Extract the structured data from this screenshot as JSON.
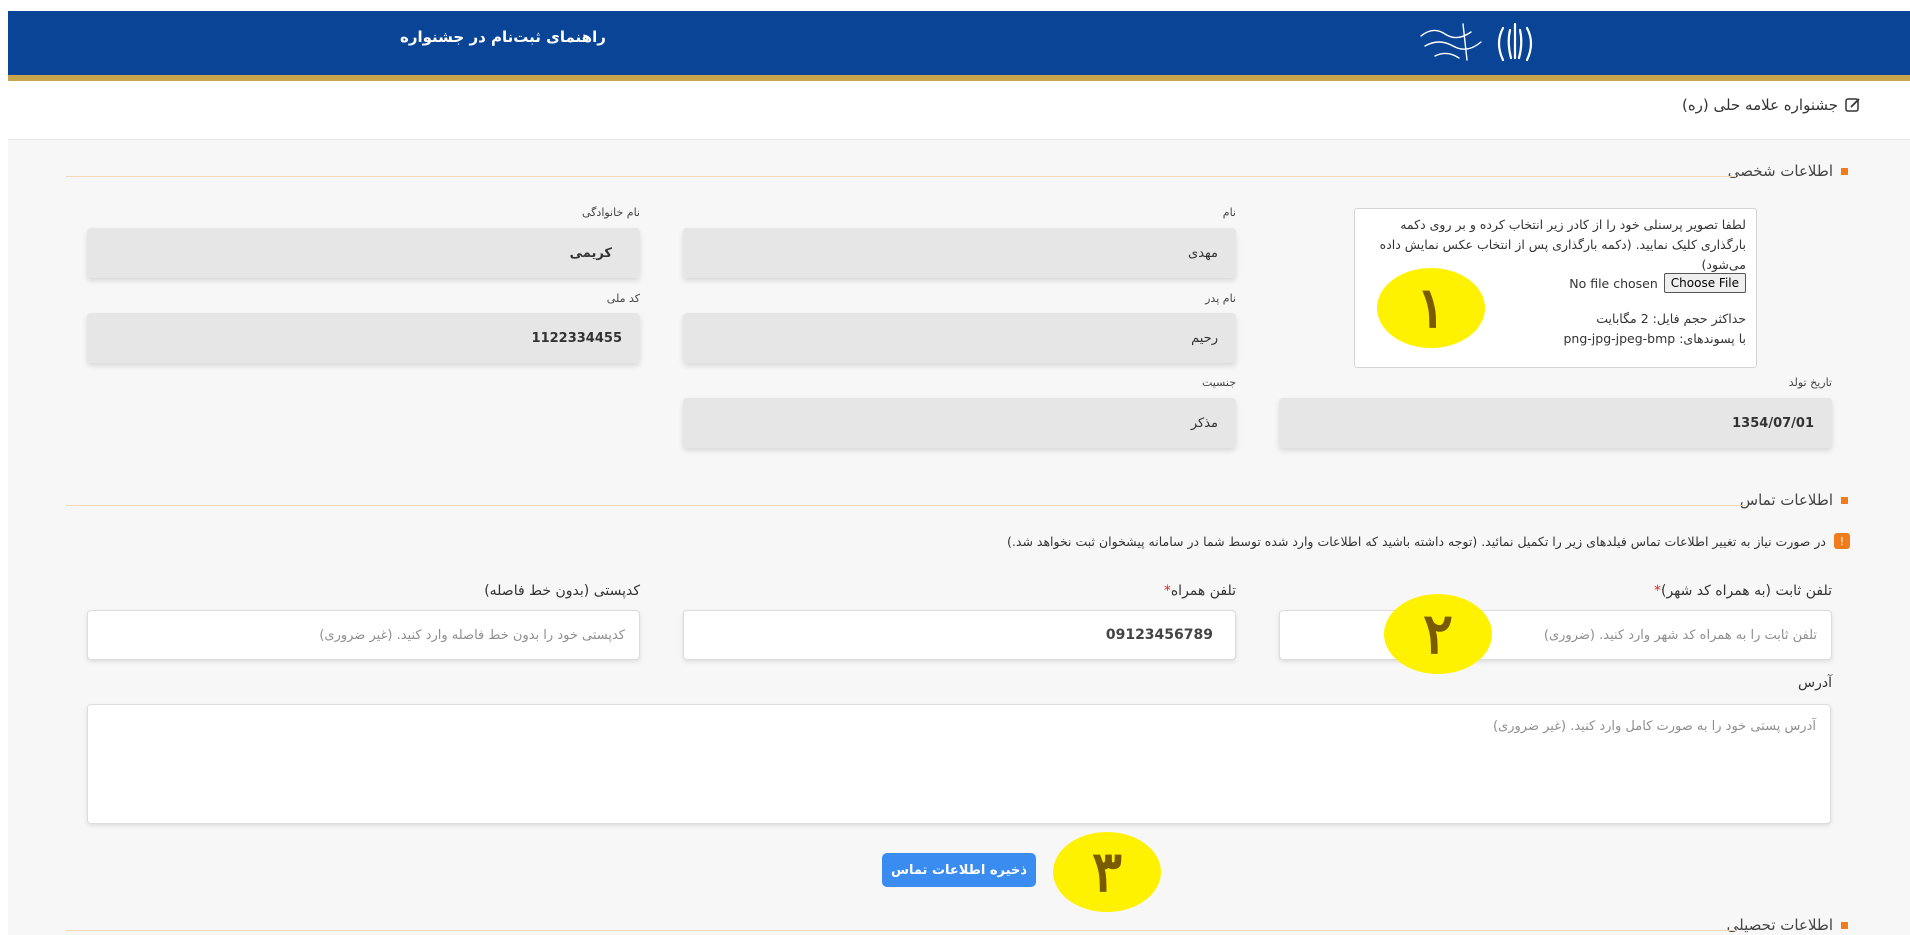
{
  "header": {
    "guide_link": "راهنمای ثبت‌نام در جشنواره"
  },
  "festival": {
    "title": "جشنواره علامه حلی (ره)"
  },
  "personal": {
    "section_title": "اطلاعات شخصی",
    "upload_instructions": "لطفا تصویر پرسنلی خود را از کادر زیر انتخاب کرده و بر روی دکمه بارگذاری کلیک نمایید. (دکمه بارگذاری پس از انتخاب عکس نمایش داده می‌شود)",
    "choose_file_label": "Choose File",
    "no_file_text": "No file chosen",
    "max_size": "حداکثر حجم فایل: 2 مگابایت",
    "extensions": "با پسوندهای: png-jpg-jpeg-bmp",
    "first_name_label": "نام",
    "first_name": "مهدی",
    "last_name_label": "نام خانوادگی",
    "last_name": "کریمی",
    "father_name_label": "نام پدر",
    "father_name": "رحیم",
    "national_code_label": "کد ملی",
    "national_code": "1122334455",
    "birth_date_label": "تاریخ تولد",
    "birth_date": "1354/07/01",
    "gender_label": "جنسیت",
    "gender": "مذکر"
  },
  "contact": {
    "section_title": "اطلاعات تماس",
    "warning": "در صورت نیاز به تغییر اطلاعات تماس فیلدهای زیر را تکمیل نمائید. (توجه داشته باشید که اطلاعات وارد شده توسط شما در سامانه پیشخوان ثبت نخواهد شد.)",
    "landline_label": "تلفن ثابت (به همراه کد شهر)",
    "landline_placeholder": "تلفن ثابت را به همراه کد شهر وارد کنید. (ضروری)",
    "mobile_label": "تلفن همراه",
    "mobile": "09123456789",
    "postal_label": "کدپستی (بدون خط فاصله)",
    "postal_placeholder": "کدپستی خود را بدون خط فاصله وارد کنید. (غیر ضروری)",
    "address_label": "آدرس",
    "address_placeholder": "آدرس پستی خود را به صورت کامل وارد کنید. (غیر ضروری)",
    "required_mark": "*",
    "save_button": "ذخیره اطلاعات تماس"
  },
  "education": {
    "section_title": "اطلاعات تحصیلی"
  },
  "markers": [
    "۱",
    "۲",
    "۳"
  ],
  "colors": {
    "header_bg": "#0a4496",
    "header_stripe": "#c8a44a",
    "accent_orange": "#f07c1c",
    "save_button": "#3b8cf0",
    "marker_yellow": "#fff200"
  }
}
